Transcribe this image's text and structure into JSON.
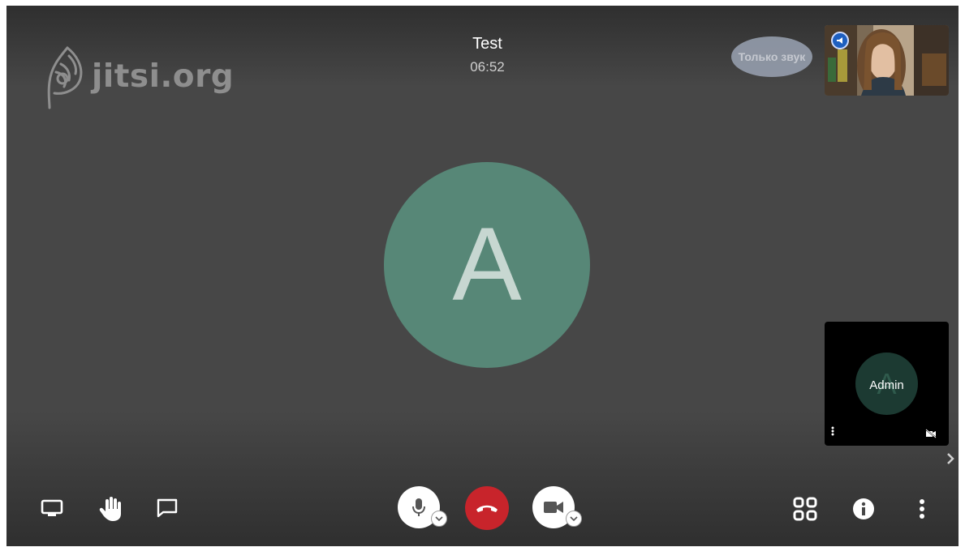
{
  "conference": {
    "title": "Test",
    "timer": "06:52"
  },
  "branding": {
    "logo_text": "jitsi.org",
    "logo_color": "#8e8e8e"
  },
  "filmstrip": {
    "audio_only_label": "Только звук",
    "remote_participant": {
      "dominant_speaker_icon": "megaphone-icon",
      "badge_color": "#1e5fbf"
    },
    "local_participant": {
      "name": "Admin",
      "avatar_letter": "A",
      "camera_muted_icon": "camera-off-icon",
      "menu_icon": "more-vertical-icon"
    },
    "next_icon": "chevron-right-icon"
  },
  "main_stage": {
    "avatar_letter": "A",
    "avatar_color": "#578777"
  },
  "toolbar": {
    "left": [
      {
        "name": "share-screen-button",
        "icon": "desktop-icon"
      },
      {
        "name": "raise-hand-button",
        "icon": "hand-icon"
      },
      {
        "name": "chat-button",
        "icon": "chat-bubble-icon"
      }
    ],
    "center": [
      {
        "name": "microphone-button",
        "icon": "microphone-icon"
      },
      {
        "name": "hangup-button",
        "icon": "phone-hangup-icon",
        "color": "#c8242b"
      },
      {
        "name": "camera-button",
        "icon": "video-camera-icon"
      }
    ],
    "right": [
      {
        "name": "tile-view-button",
        "icon": "grid-icon"
      },
      {
        "name": "info-button",
        "icon": "info-icon"
      },
      {
        "name": "more-options-button",
        "icon": "more-vertical-icon"
      }
    ]
  }
}
